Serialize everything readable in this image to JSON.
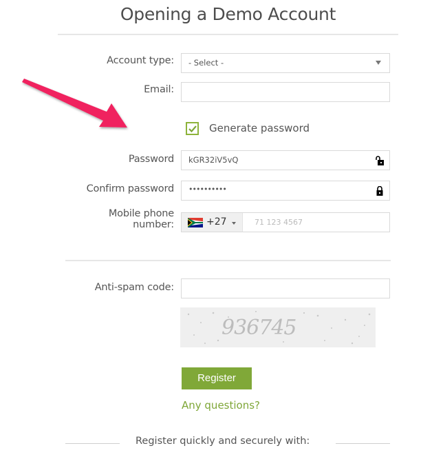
{
  "title": "Opening a Demo Account",
  "form": {
    "account_type": {
      "label": "Account type:",
      "value": "- Select -"
    },
    "email": {
      "label": "Email:",
      "value": ""
    },
    "generate_password": {
      "label": "Generate password",
      "checked": true
    },
    "password": {
      "label": "Password",
      "value": "kGR32iV5vQ",
      "icon": "unlock-icon"
    },
    "confirm_password": {
      "label": "Confirm password",
      "value": "••••••••••",
      "icon": "lock-icon"
    },
    "mobile": {
      "label_line1": "Mobile phone",
      "label_line2": "number:",
      "country": "South Africa",
      "dial_code": "+27",
      "placeholder": "71 123 4567"
    },
    "anti_spam": {
      "label": "Anti-spam code:",
      "value": ""
    },
    "captcha_text": "936745",
    "register_label": "Register",
    "questions_link": "Any questions?",
    "social_caption": "Register quickly and securely with:"
  },
  "colors": {
    "accent": "#80a838",
    "link": "#7ea637",
    "annotation_arrow": "#f0245f"
  }
}
